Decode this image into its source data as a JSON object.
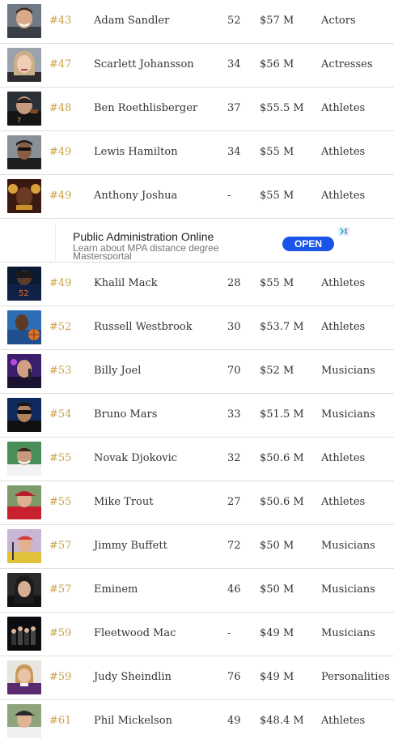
{
  "rows_top": [
    {
      "rank": "#43",
      "name": "Adam Sandler",
      "age": "52",
      "earnings": "$57 M",
      "category": "Actors",
      "photo": "adam-sandler-photo"
    },
    {
      "rank": "#47",
      "name": "Scarlett Johansson",
      "age": "34",
      "earnings": "$56 M",
      "category": "Actresses",
      "photo": "scarlett-johansson-photo"
    },
    {
      "rank": "#48",
      "name": "Ben Roethlisberger",
      "age": "37",
      "earnings": "$55.5 M",
      "category": "Athletes",
      "photo": "ben-roethlisberger-photo"
    },
    {
      "rank": "#49",
      "name": "Lewis Hamilton",
      "age": "34",
      "earnings": "$55 M",
      "category": "Athletes",
      "photo": "lewis-hamilton-photo"
    },
    {
      "rank": "#49",
      "name": "Anthony Joshua",
      "age": "-",
      "earnings": "$55 M",
      "category": "Athletes",
      "photo": "anthony-joshua-photo"
    }
  ],
  "ad": {
    "title": "Public Administration Online",
    "subtitle": "Learn about MPA distance degree",
    "source": "Mastersportal",
    "button": "OPEN",
    "choice_icon": "adchoices-icon"
  },
  "rows_bottom": [
    {
      "rank": "#49",
      "name": "Khalil Mack",
      "age": "28",
      "earnings": "$55 M",
      "category": "Athletes",
      "photo": "khalil-mack-photo"
    },
    {
      "rank": "#52",
      "name": "Russell Westbrook",
      "age": "30",
      "earnings": "$53.7 M",
      "category": "Athletes",
      "photo": "russell-westbrook-photo"
    },
    {
      "rank": "#53",
      "name": "Billy Joel",
      "age": "70",
      "earnings": "$52 M",
      "category": "Musicians",
      "photo": "billy-joel-photo"
    },
    {
      "rank": "#54",
      "name": "Bruno Mars",
      "age": "33",
      "earnings": "$51.5 M",
      "category": "Musicians",
      "photo": "bruno-mars-photo"
    },
    {
      "rank": "#55",
      "name": "Novak Djokovic",
      "age": "32",
      "earnings": "$50.6 M",
      "category": "Athletes",
      "photo": "novak-djokovic-photo"
    },
    {
      "rank": "#55",
      "name": "Mike Trout",
      "age": "27",
      "earnings": "$50.6 M",
      "category": "Athletes",
      "photo": "mike-trout-photo"
    },
    {
      "rank": "#57",
      "name": "Jimmy Buffett",
      "age": "72",
      "earnings": "$50 M",
      "category": "Musicians",
      "photo": "jimmy-buffett-photo"
    },
    {
      "rank": "#57",
      "name": "Eminem",
      "age": "46",
      "earnings": "$50 M",
      "category": "Musicians",
      "photo": "eminem-photo"
    },
    {
      "rank": "#59",
      "name": "Fleetwood Mac",
      "age": "-",
      "earnings": "$49 M",
      "category": "Musicians",
      "photo": "fleetwood-mac-photo"
    },
    {
      "rank": "#59",
      "name": "Judy Sheindlin",
      "age": "76",
      "earnings": "$49 M",
      "category": "Personalities",
      "photo": "judy-sheindlin-photo"
    },
    {
      "rank": "#61",
      "name": "Phil Mickelson",
      "age": "49",
      "earnings": "$48.4 M",
      "category": "Athletes",
      "photo": "phil-mickelson-photo"
    }
  ],
  "colors": {
    "rank": "#c9a24a",
    "text": "#333333",
    "divider": "#dedede",
    "ad_button": "#1a53e8"
  }
}
